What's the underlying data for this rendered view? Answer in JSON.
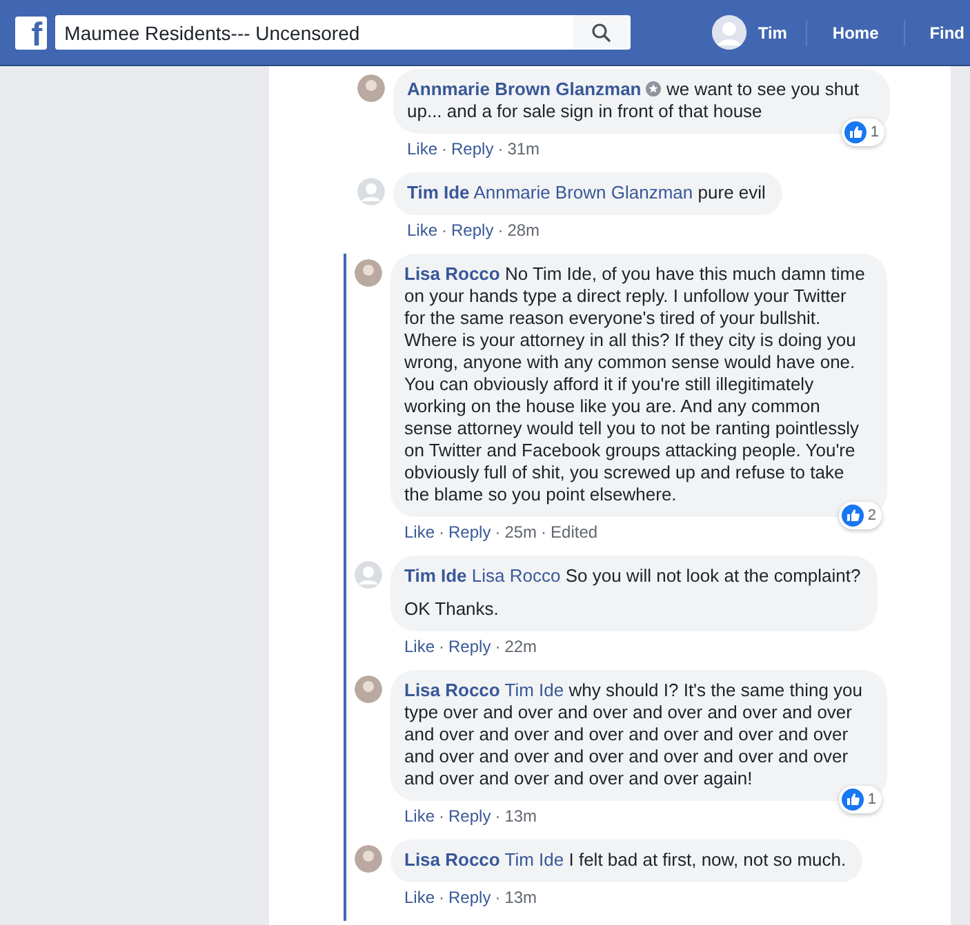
{
  "topbar": {
    "logo": "f",
    "search": {
      "value": "Maumee Residents--- Uncensored"
    },
    "profile_name": "Tim",
    "nav": [
      "Home",
      "Find"
    ]
  },
  "separator": "·",
  "comments": [
    {
      "author": "Annmarie Brown Glanzman",
      "badge": true,
      "paragraphs": [
        "we want to see you shut up... and a for sale sign in front of that house"
      ],
      "reactions": "1",
      "actions": [
        "Like",
        "Reply"
      ],
      "time": "31m",
      "in_thread": false,
      "avatar_photo": true
    },
    {
      "author": "Tim Ide",
      "badge": false,
      "mention": "Annmarie Brown Glanzman",
      "paragraphs": [
        "pure evil"
      ],
      "actions": [
        "Like",
        "Reply"
      ],
      "time": "28m",
      "in_thread": false,
      "avatar_photo": false
    },
    {
      "author": "Lisa Rocco",
      "badge": false,
      "paragraphs": [
        "No Tim Ide, of you have this much damn time on your hands type a direct reply. I unfollow your Twitter for the same reason everyone's tired of your bullshit. Where is your attorney in all this? If they city is doing you wrong, anyone with any common sense would have one. You can obviously afford it if you're still illegitimately working on the house like you are. And any common sense attorney would tell you to not be ranting pointlessly on Twitter and Facebook groups attacking people. You're obviously full of shit, you screwed up and refuse to take the blame so you point elsewhere."
      ],
      "reactions": "2",
      "actions": [
        "Like",
        "Reply"
      ],
      "time": "25m",
      "edited": "Edited",
      "in_thread": true,
      "avatar_photo": true
    },
    {
      "author": "Tim Ide",
      "badge": false,
      "mention": "Lisa Rocco",
      "paragraphs": [
        "So you will not look at the complaint?",
        "OK Thanks."
      ],
      "actions": [
        "Like",
        "Reply"
      ],
      "time": "22m",
      "in_thread": true,
      "avatar_photo": false
    },
    {
      "author": "Lisa Rocco",
      "badge": false,
      "mention": "Tim Ide",
      "paragraphs": [
        "why should I? It's the same thing you type over and over and over and over and over and over and over and over and over and over and over and over and over and over and over and over and over and over and over and over and over and over again!"
      ],
      "reactions": "1",
      "actions": [
        "Like",
        "Reply"
      ],
      "time": "13m",
      "in_thread": true,
      "avatar_photo": true
    },
    {
      "author": "Lisa Rocco",
      "badge": false,
      "mention": "Tim Ide",
      "paragraphs": [
        "I felt bad at first, now, not so much."
      ],
      "actions": [
        "Like",
        "Reply"
      ],
      "time": "13m",
      "in_thread": true,
      "avatar_photo": true
    }
  ]
}
